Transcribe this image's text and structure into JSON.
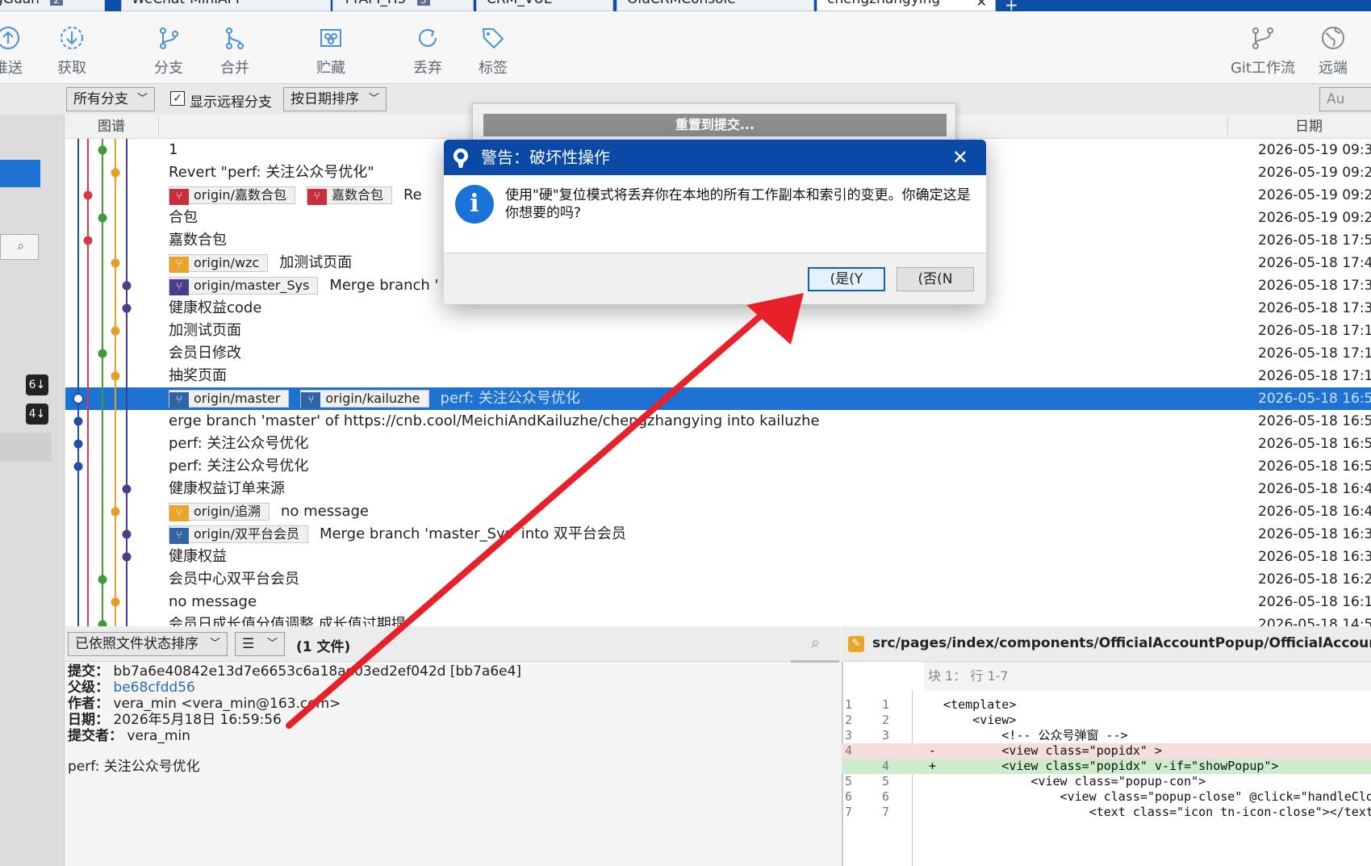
{
  "tabs": [
    {
      "label": "gGuan",
      "badge": "2"
    },
    {
      "label": "WeChat-MiniAPI"
    },
    {
      "label": "YYAPI_H5",
      "badge": "3"
    },
    {
      "label": "CRM_VUE"
    },
    {
      "label": "OldCRMConsole"
    },
    {
      "label": "chengzhangying",
      "close": "✕"
    }
  ],
  "tab_plus": "+",
  "toolbar": {
    "push": "推送",
    "fetch": "获取",
    "branch": "分支",
    "merge": "合并",
    "stash": "贮藏",
    "discard": "丢弃",
    "tag": "标签",
    "gitflow": "Git工作流",
    "remote": "远端"
  },
  "filter": {
    "branches": "所有分支",
    "show_remote_check": "✓",
    "show_remote": "显示远程分支",
    "sort": "按日期排序",
    "search_partial": "Au"
  },
  "columns": {
    "graph": "图谱",
    "date": "日期"
  },
  "left_badges": [
    "6↓",
    "4↓"
  ],
  "commits": [
    {
      "tags": [],
      "msg": "1",
      "date": "2026-05-19 09:3"
    },
    {
      "tags": [],
      "msg": "Revert \"perf: 关注公众号优化\"",
      "date": "2026-05-19 09:2"
    },
    {
      "tags": [
        {
          "name": "origin/嘉数合包",
          "color": "red"
        },
        {
          "name": "嘉数合包",
          "color": "red"
        }
      ],
      "msg": "Re",
      "date": "2026-05-19 09:2"
    },
    {
      "tags": [],
      "msg": "合包",
      "date": "2026-05-19 09:2"
    },
    {
      "tags": [],
      "msg": "嘉数合包",
      "date": "2026-05-18 17:5"
    },
    {
      "tags": [
        {
          "name": "origin/wzc",
          "color": "orange"
        }
      ],
      "msg": "加测试页面",
      "date": "2026-05-18 17:4"
    },
    {
      "tags": [
        {
          "name": "origin/master_Sys",
          "color": "purple"
        }
      ],
      "msg": "Merge branch '",
      "date": "2026-05-18 17:3"
    },
    {
      "tags": [],
      "msg": "健康权益code",
      "date": "2026-05-18 17:3"
    },
    {
      "tags": [],
      "msg": "加测试页面",
      "date": "2026-05-18 17:1"
    },
    {
      "tags": [],
      "msg": "会员日修改",
      "date": "2026-05-18 17:1"
    },
    {
      "tags": [],
      "msg": "抽奖页面",
      "date": "2026-05-18 17:1"
    },
    {
      "tags": [
        {
          "name": "origin/master",
          "color": "blue"
        },
        {
          "name": "origin/kailuzhe",
          "color": "blue"
        }
      ],
      "msg": "perf: 关注公众号优化",
      "date": "2026-05-18 16:5",
      "selected": true
    },
    {
      "tags": [],
      "msg": "erge branch 'master' of https://cnb.cool/MeichiAndKailuzhe/chengzhangying into kailuzhe",
      "date": "2026-05-18 16:5"
    },
    {
      "tags": [],
      "msg": "perf: 关注公众号优化",
      "date": "2026-05-18 16:5"
    },
    {
      "tags": [],
      "msg": "perf: 关注公众号优化",
      "date": "2026-05-18 16:5"
    },
    {
      "tags": [],
      "msg": "健康权益订单来源",
      "date": "2026-05-18 16:4"
    },
    {
      "tags": [
        {
          "name": "origin/追溯",
          "color": "orange"
        }
      ],
      "msg": "no message",
      "date": "2026-05-18 16:4"
    },
    {
      "tags": [
        {
          "name": "origin/双平台会员",
          "color": "blue"
        }
      ],
      "msg": "Merge branch 'master_Sys' into 双平台会员",
      "date": "2026-05-18 16:3"
    },
    {
      "tags": [],
      "msg": "健康权益",
      "date": "2026-05-18 16:3"
    },
    {
      "tags": [],
      "msg": "会员中心双平台会员",
      "date": "2026-05-18 16:2"
    },
    {
      "tags": [],
      "msg": "no message",
      "date": "2026-05-18 16:1"
    },
    {
      "tags": [],
      "msg": "会员日成长值分值调整 成长值过期提",
      "date": "2026-05-18 14:5"
    }
  ],
  "files_bar": {
    "sort": "已依照文件状态排序",
    "view": "☰",
    "count": "(1 文件)"
  },
  "details": {
    "commit_label": "提交：",
    "commit": "bb7a6e40842e13d7e6653c6a18ae03ed2ef042d [bb7a6e4]",
    "parent_label": "父级：",
    "parent": "be68cfdd56",
    "author_label": "作者：",
    "author": "vera_min <vera_min@163.com>",
    "date_label": "日期：",
    "date": "2026年5月18日 16:59:56",
    "committer_label": "提交者：",
    "committer": "vera_min",
    "message": "perf: 关注公众号优化"
  },
  "diff": {
    "path": "src/pages/index/components/OfficialAccountPopup/OfficialAccountPopu",
    "hunk": "块 1： 行 1-7",
    "lines": [
      {
        "n1": "1",
        "n2": "1",
        "code": "  <template>",
        "kind": ""
      },
      {
        "n1": "2",
        "n2": "2",
        "code": "      <view>",
        "kind": ""
      },
      {
        "n1": "3",
        "n2": "3",
        "code": "          <!-- 公众号弹窗 -->",
        "kind": ""
      },
      {
        "n1": "4",
        "n2": "",
        "code": "-         <view class=\"popidx\" >",
        "kind": "del"
      },
      {
        "n1": "",
        "n2": "4",
        "code": "+         <view class=\"popidx\" v-if=\"showPopup\">",
        "kind": "add"
      },
      {
        "n1": "5",
        "n2": "5",
        "code": "              <view class=\"popup-con\">",
        "kind": ""
      },
      {
        "n1": "6",
        "n2": "6",
        "code": "                  <view class=\"popup-close\" @click=\"handleClo",
        "kind": ""
      },
      {
        "n1": "7",
        "n2": "7",
        "code": "                      <text class=\"icon tn-icon-close\"></text",
        "kind": ""
      }
    ]
  },
  "background_dialog": {
    "button": "重置到提交..."
  },
  "dialog": {
    "title": "警告：破坏性操作",
    "close": "✕",
    "info_icon": "i",
    "message": "使用\"硬\"复位模式将丢弃你在本地的所有工作副本和索引的变更。你确定这是你想要的吗?",
    "yes": "(是(Y",
    "no": "(否(N"
  },
  "colors": {
    "accent": "#0a49a6",
    "selection": "#1e73d2",
    "annotation_arrow": "#e8202a"
  }
}
